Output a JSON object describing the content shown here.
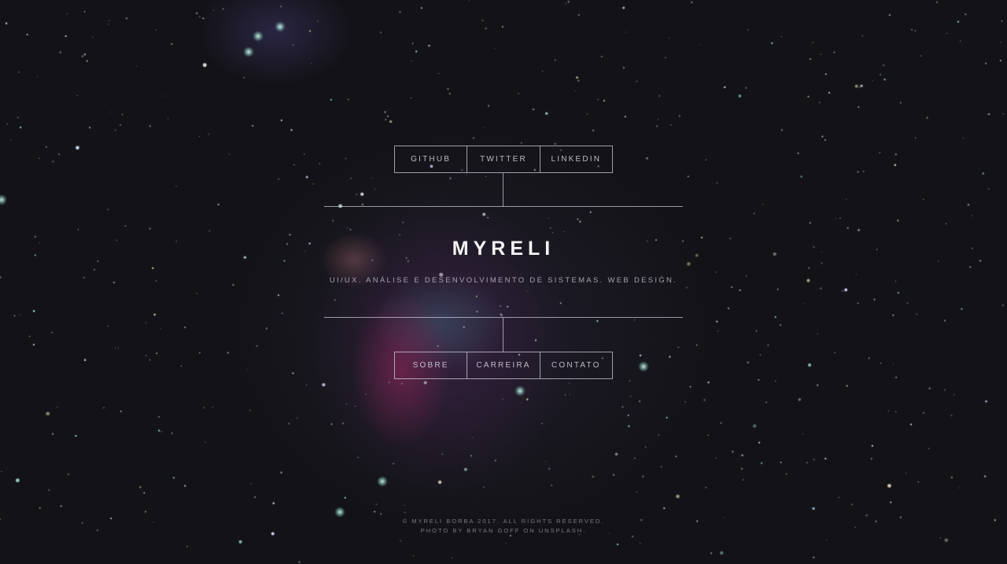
{
  "top_nav": {
    "items": [
      "GITHUB",
      "TWITTER",
      "LINKEDIN"
    ]
  },
  "hero": {
    "brand": "MYRELI",
    "tagline": "UI/UX. ANÁLISE E DESENVOLVIMENTO DE SISTEMAS. WEB DESIGN."
  },
  "bottom_nav": {
    "items": [
      "SOBRE",
      "CARREIRA",
      "CONTATO"
    ]
  },
  "footer": {
    "copyright": "© MYRELI BORBA 2017. ALL RIGHTS RESERVED.",
    "credit": "PHOTO BY BRYAN GOFF ON UNSPLASH."
  },
  "colors": {
    "background": "#131317",
    "text": "#f4f4f6",
    "line": "#d2d2dc"
  }
}
